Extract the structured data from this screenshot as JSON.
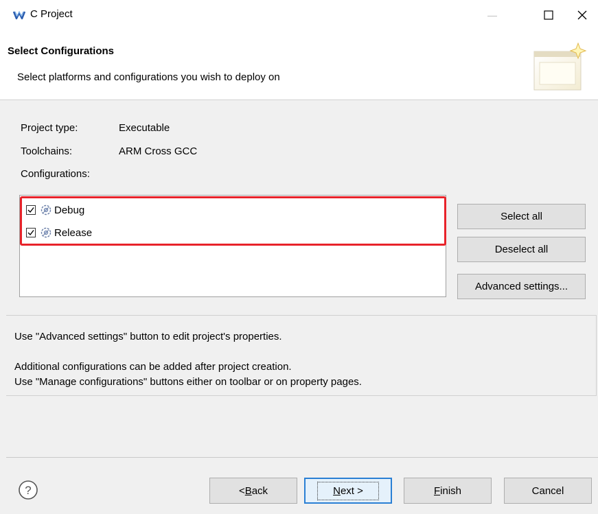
{
  "window": {
    "title": "C Project",
    "minimize_glyph": "—",
    "maximize_glyph": "☐",
    "close_glyph": "✕"
  },
  "header": {
    "title": "Select Configurations",
    "description": "Select platforms and configurations you wish to deploy on"
  },
  "info": {
    "project_type_label": "Project type:",
    "project_type_value": "Executable",
    "toolchains_label": "Toolchains:",
    "toolchains_value": "ARM Cross GCC",
    "configurations_label": "Configurations:"
  },
  "configurations": [
    {
      "label": "Debug",
      "checked": true
    },
    {
      "label": "Release",
      "checked": true
    }
  ],
  "side_buttons": {
    "select_all": "Select all",
    "deselect_all": "Deselect all",
    "advanced": "Advanced settings..."
  },
  "help_text": {
    "line1": "Use \"Advanced settings\" button to edit project's properties.",
    "line2": "Additional configurations can be added after project creation.",
    "line3": "Use \"Manage configurations\" buttons either on toolbar or on property pages."
  },
  "footer": {
    "help_glyph": "?",
    "back_prefix": "< ",
    "back_mnemonic": "B",
    "back_rest": "ack",
    "next_mnemonic": "N",
    "next_rest": "ext >",
    "finish_mnemonic": "F",
    "finish_rest": "inish",
    "cancel": "Cancel"
  },
  "colors": {
    "highlight": "#e8232a",
    "default_button_border": "#2a7fd4"
  }
}
